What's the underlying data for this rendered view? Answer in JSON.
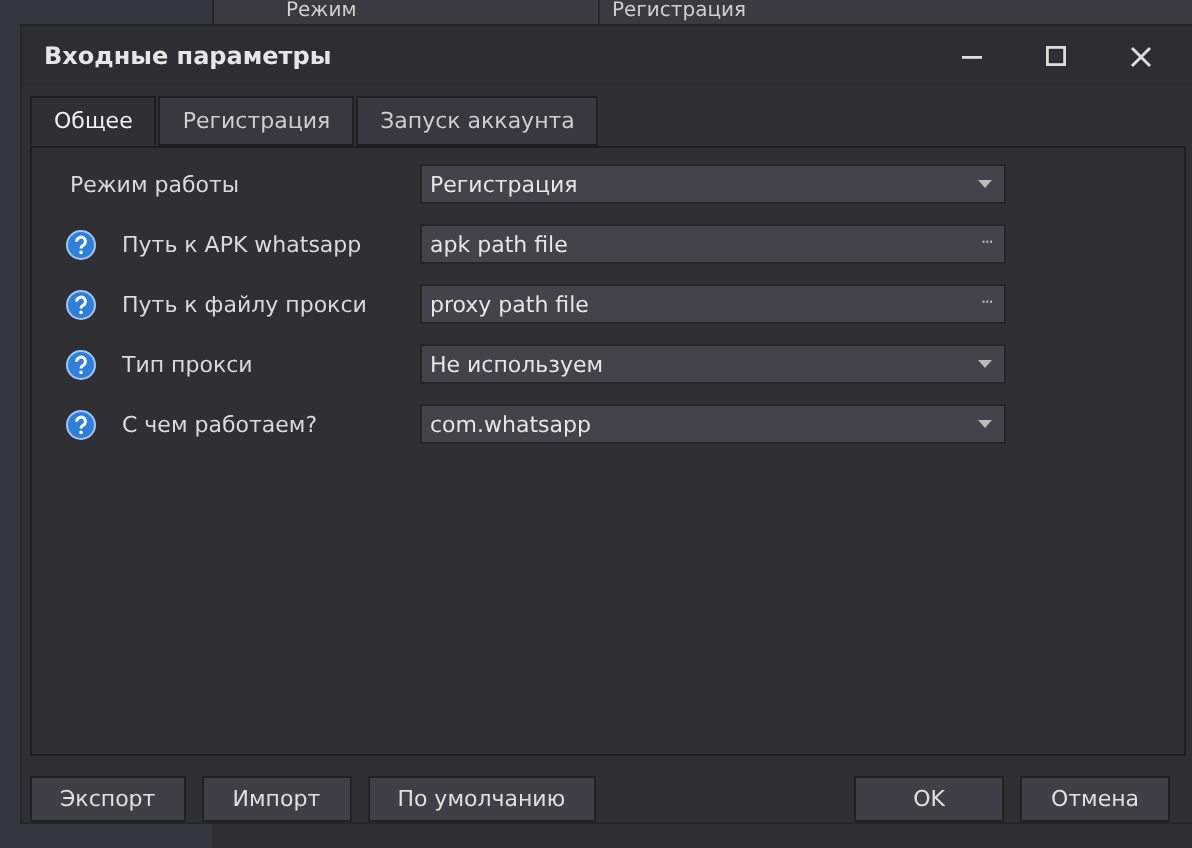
{
  "background_table": {
    "columns": [
      "Режим",
      "Регистрация"
    ]
  },
  "window": {
    "title": "Входные параметры"
  },
  "tabs": [
    {
      "label": "Общее",
      "selected": true
    },
    {
      "label": "Регистрация",
      "selected": false
    },
    {
      "label": "Запуск аккаунта",
      "selected": false
    }
  ],
  "settings": [
    {
      "label": "Режим работы",
      "help": false,
      "kind": "dropdown",
      "value": "Регистрация"
    },
    {
      "label": "Путь к APK whatsapp",
      "help": true,
      "kind": "file",
      "value": "apk path file",
      "button": "···"
    },
    {
      "label": "Путь к файлу прокси",
      "help": true,
      "kind": "file",
      "value": "proxy path file",
      "button": "···"
    },
    {
      "label": "Тип прокси",
      "help": true,
      "kind": "dropdown",
      "value": "Не используем"
    },
    {
      "label": "С чем работаем?",
      "help": true,
      "kind": "dropdown",
      "value": "com.whatsapp"
    }
  ],
  "left_buttons": [
    "Экспорт",
    "Импорт",
    "По умолчанию"
  ],
  "right_buttons": [
    "OK",
    "Отмена"
  ]
}
